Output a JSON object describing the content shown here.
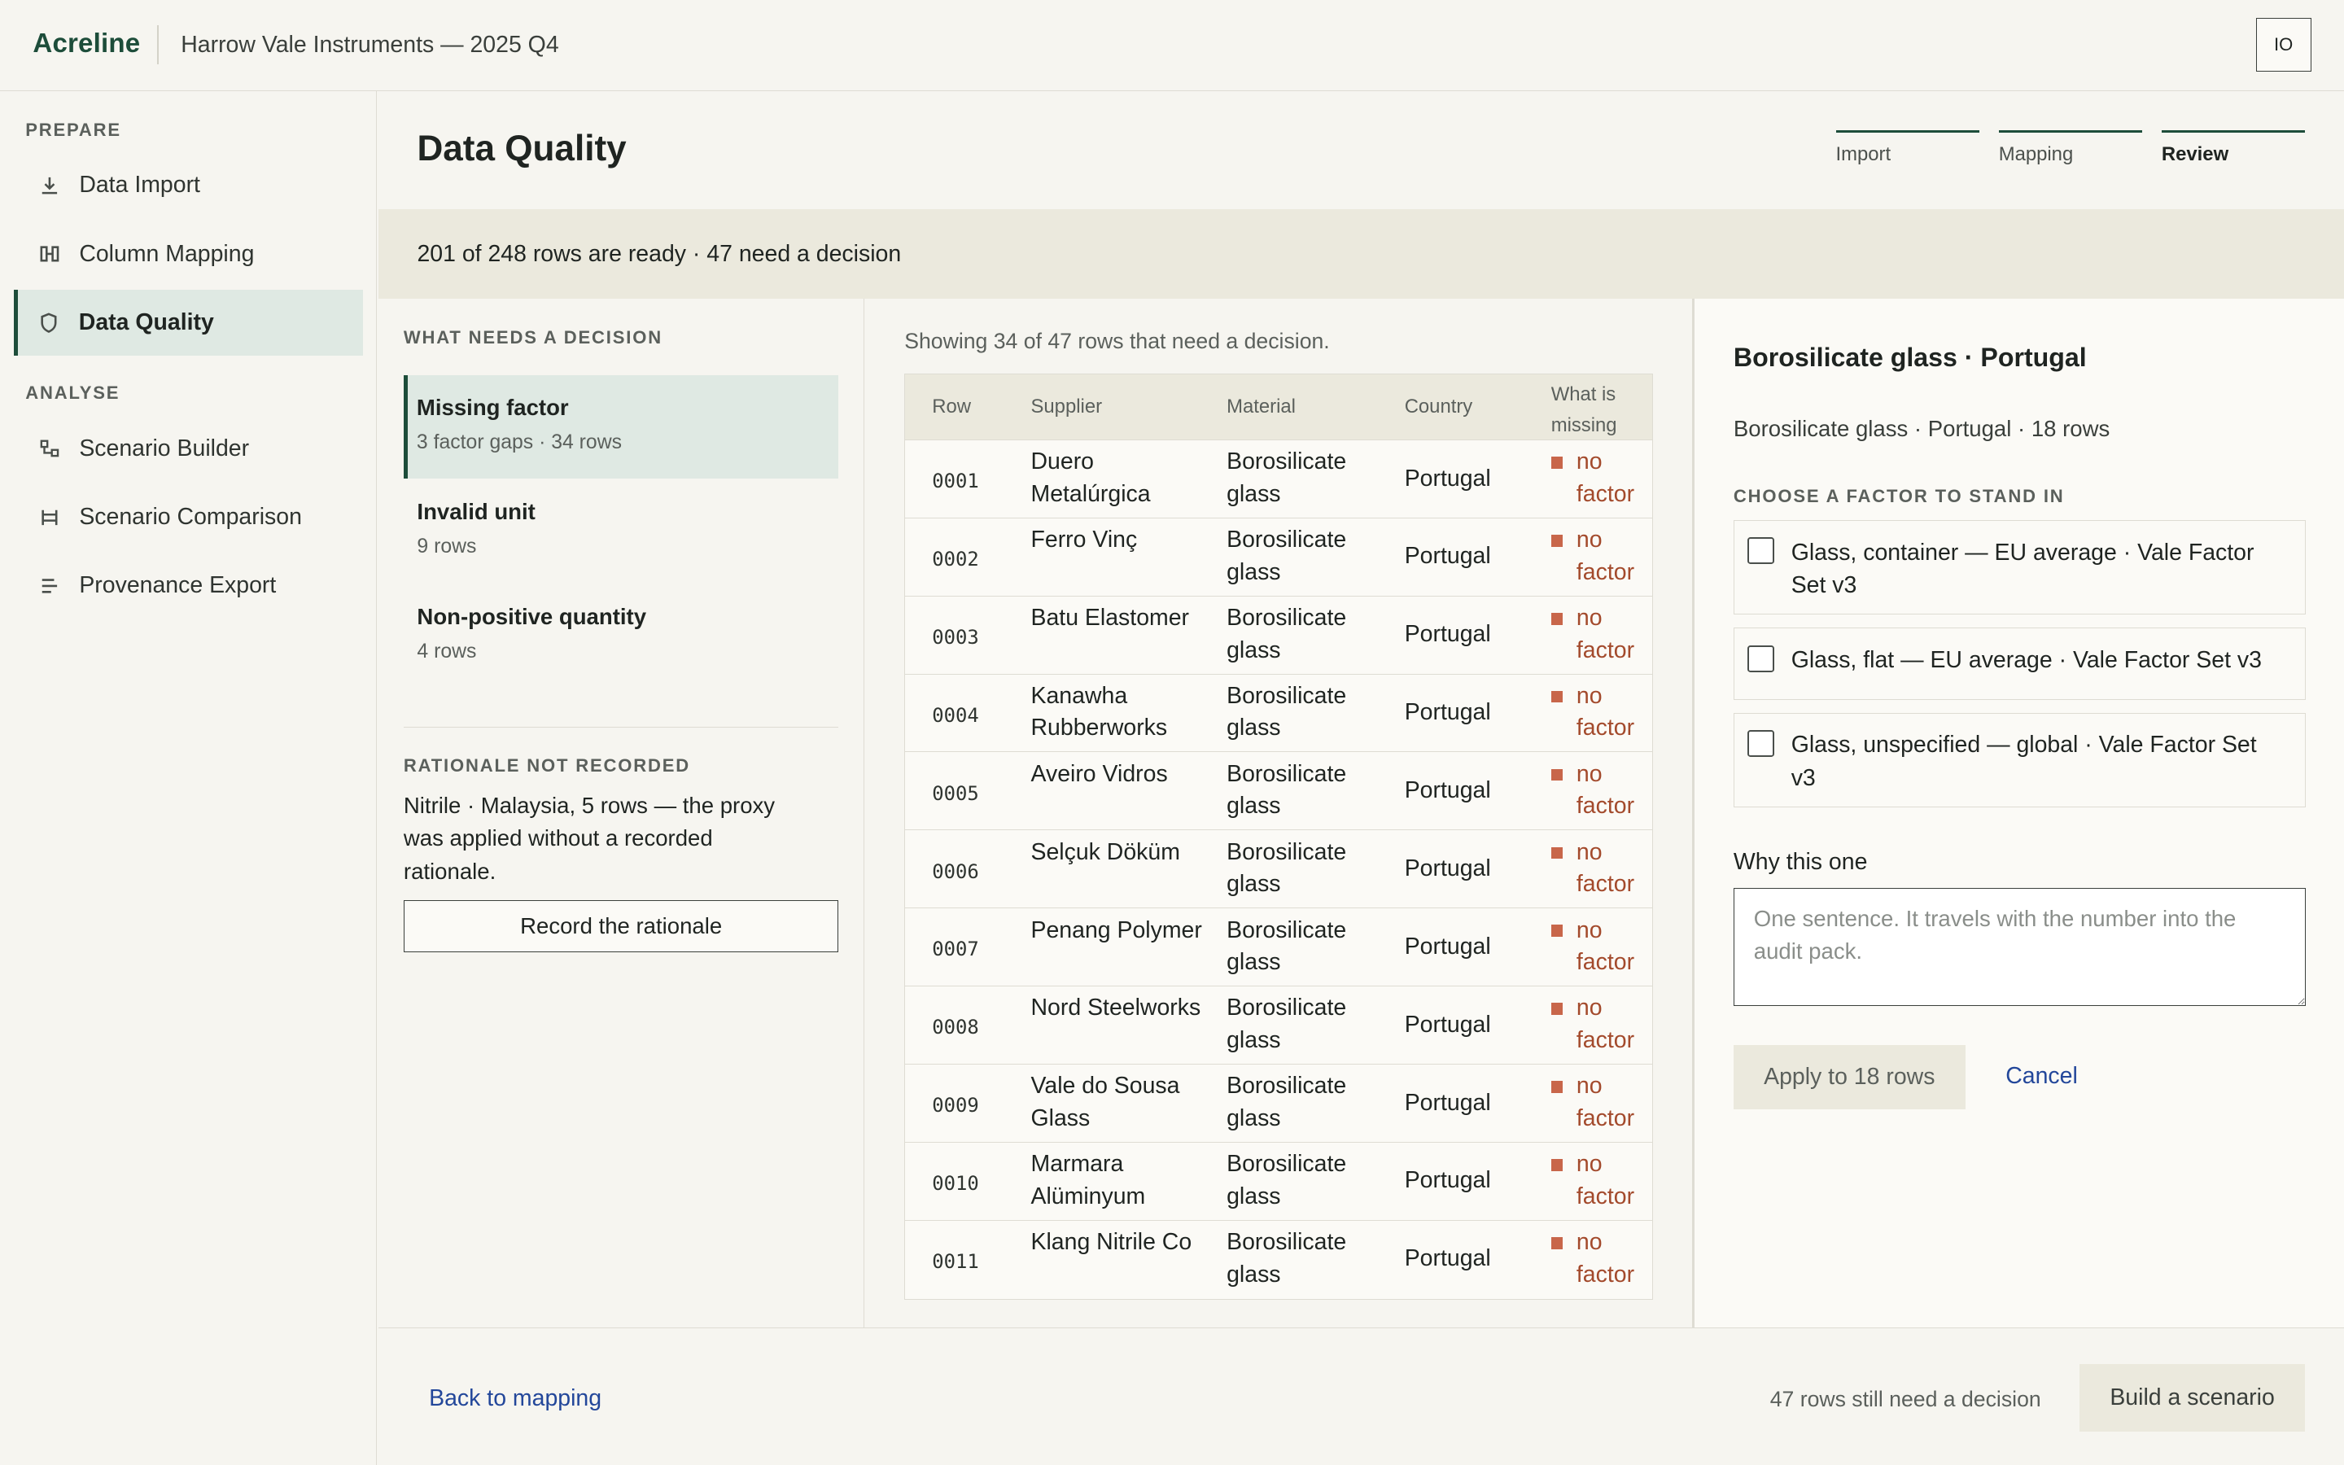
{
  "app": {
    "brand": "Acreline",
    "org": "Harrow Vale Instruments — 2025 Q4",
    "avatar_initials": "IO"
  },
  "sidebar": {
    "sections": [
      {
        "label": "PREPARE",
        "items": [
          {
            "label": "Data Import",
            "icon": "download-icon",
            "active": false
          },
          {
            "label": "Column Mapping",
            "icon": "columns-icon",
            "active": false
          },
          {
            "label": "Data Quality",
            "icon": "shield-icon",
            "active": true
          }
        ]
      },
      {
        "label": "ANALYSE",
        "items": [
          {
            "label": "Scenario Builder",
            "icon": "flow-icon",
            "active": false
          },
          {
            "label": "Scenario Comparison",
            "icon": "compare-icon",
            "active": false
          },
          {
            "label": "Provenance Export",
            "icon": "list-icon",
            "active": false
          }
        ]
      }
    ]
  },
  "header": {
    "title": "Data Quality",
    "steps": [
      {
        "label": "Import",
        "current": false
      },
      {
        "label": "Mapping",
        "current": false
      },
      {
        "label": "Review",
        "current": true
      }
    ]
  },
  "banner": {
    "text": "201 of 248 rows are ready · 47 need a decision"
  },
  "issues": {
    "label": "WHAT NEEDS A DECISION",
    "groups": [
      {
        "title": "Missing factor",
        "sub": "3 factor gaps · 34 rows",
        "active": true
      },
      {
        "title": "Invalid unit",
        "sub": "9 rows",
        "active": false
      },
      {
        "title": "Non-positive quantity",
        "sub": "4 rows",
        "active": false
      }
    ],
    "rationale": {
      "label": "RATIONALE NOT RECORDED",
      "text": "Nitrile · Malaysia, 5 rows — the proxy was applied without a recorded rationale.",
      "button": "Record the rationale"
    }
  },
  "table": {
    "showing": "Showing 34 of 47 rows that need a decision.",
    "columns": [
      "Row",
      "Supplier",
      "Material",
      "Country",
      "What is missing"
    ],
    "rows": [
      {
        "row": "0001",
        "supplier": "Duero Metalúrgica",
        "material": "Borosilicate glass",
        "country": "Portugal",
        "missing": "no factor"
      },
      {
        "row": "0002",
        "supplier": "Ferro Vinç",
        "material": "Borosilicate glass",
        "country": "Portugal",
        "missing": "no factor"
      },
      {
        "row": "0003",
        "supplier": "Batu Elastomer",
        "material": "Borosilicate glass",
        "country": "Portugal",
        "missing": "no factor"
      },
      {
        "row": "0004",
        "supplier": "Kanawha Rubberworks",
        "material": "Borosilicate glass",
        "country": "Portugal",
        "missing": "no factor"
      },
      {
        "row": "0005",
        "supplier": "Aveiro Vidros",
        "material": "Borosilicate glass",
        "country": "Portugal",
        "missing": "no factor"
      },
      {
        "row": "0006",
        "supplier": "Selçuk Döküm",
        "material": "Borosilicate glass",
        "country": "Portugal",
        "missing": "no factor"
      },
      {
        "row": "0007",
        "supplier": "Penang Polymer",
        "material": "Borosilicate glass",
        "country": "Portugal",
        "missing": "no factor"
      },
      {
        "row": "0008",
        "supplier": "Nord Steelworks",
        "material": "Borosilicate glass",
        "country": "Portugal",
        "missing": "no factor"
      },
      {
        "row": "0009",
        "supplier": "Vale do Sousa Glass",
        "material": "Borosilicate glass",
        "country": "Portugal",
        "missing": "no factor"
      },
      {
        "row": "0010",
        "supplier": "Marmara Alüminyum",
        "material": "Borosilicate glass",
        "country": "Portugal",
        "missing": "no factor"
      },
      {
        "row": "0011",
        "supplier": "Klang Nitrile Co",
        "material": "Borosilicate glass",
        "country": "Portugal",
        "missing": "no factor"
      }
    ]
  },
  "panel": {
    "title": "Borosilicate glass · Portugal",
    "sub": "Borosilicate glass · Portugal · 18 rows",
    "choose_label": "CHOOSE A FACTOR TO STAND IN",
    "options": [
      {
        "label": "Glass, container — EU average · Vale Factor Set v3",
        "checked": false
      },
      {
        "label": "Glass, flat — EU average · Vale Factor Set v3",
        "checked": false
      },
      {
        "label": "Glass, unspecified — global · Vale Factor Set v3",
        "checked": false
      }
    ],
    "why_label": "Why this one",
    "why_placeholder": "One sentence. It travels with the number into the audit pack.",
    "why_value": "",
    "apply_label": "Apply to 18 rows",
    "cancel_label": "Cancel"
  },
  "footer": {
    "back_label": "Back to mapping",
    "status": "47 rows still need a decision",
    "build_label": "Build a scenario"
  }
}
